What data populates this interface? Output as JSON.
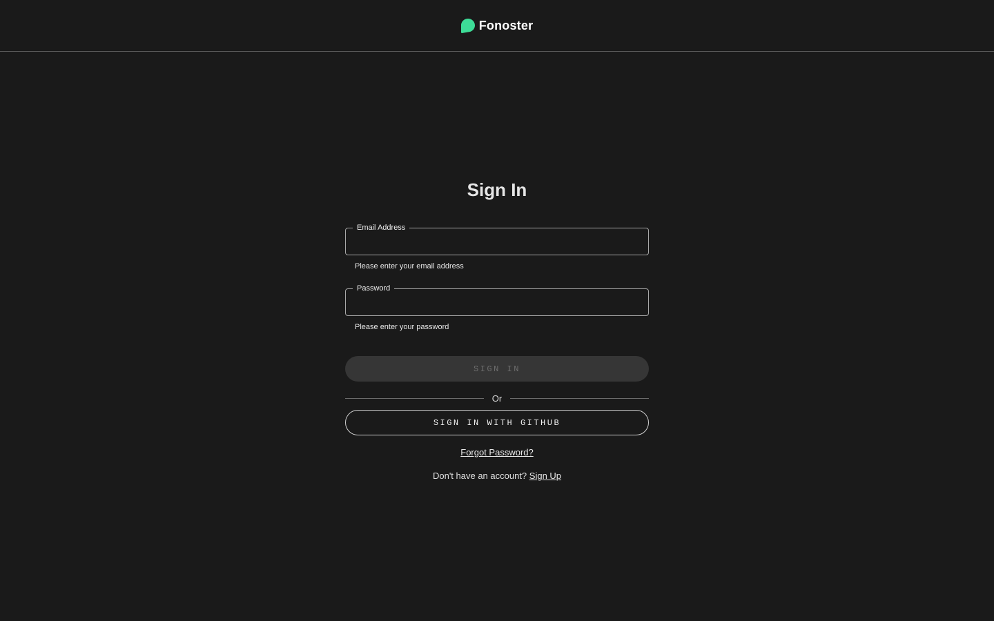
{
  "header": {
    "brand_name": "Fonoster",
    "logo_icon": "speech-bubble-icon",
    "logo_color": "#3ddc97"
  },
  "form": {
    "title": "Sign In",
    "email": {
      "label": "Email Address",
      "value": "",
      "helper": "Please enter your email address"
    },
    "password": {
      "label": "Password",
      "value": "",
      "helper": "Please enter your password"
    },
    "sign_in_button": "Sign In",
    "divider_text": "Or",
    "github_button": "Sign in with Github",
    "forgot_password": "Forgot Password?",
    "signup_prompt": "Don't have an account?",
    "signup_link": "Sign Up"
  },
  "colors": {
    "background": "#1a1a1a",
    "accent": "#3ddc97",
    "disabled_button": "#363636"
  }
}
